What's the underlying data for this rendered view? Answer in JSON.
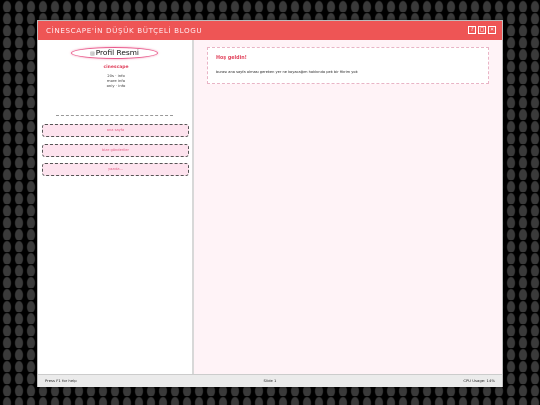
{
  "window": {
    "title": "CİNESCAPE'İN DÜŞÜK BÜTÇELİ BLOGU",
    "controls": {
      "help": "?",
      "maximize": "□",
      "close": "×"
    }
  },
  "sidebar": {
    "avatar_alt": "Profil Resmi",
    "username": "cinescape",
    "info_lines": [
      "20s · info",
      "more info",
      "only · info"
    ],
    "nav": [
      "ana sayfa",
      "bize gönderiler",
      "yazıda..."
    ]
  },
  "main": {
    "welcome_title": "Hoş geldin!",
    "welcome_text": "burası ana sayfa olması gereken yer ne koyacağım hakkında pek bir fikrim yok"
  },
  "statusbar": {
    "left": "Press F1 for help",
    "center": "Slide 1",
    "right": "CPU Usage: 14%"
  },
  "colors": {
    "titlebar": "#ee5555",
    "accent": "#e2455e",
    "main_bg": "#fff3f7",
    "nav_bg": "#fde3ee"
  }
}
